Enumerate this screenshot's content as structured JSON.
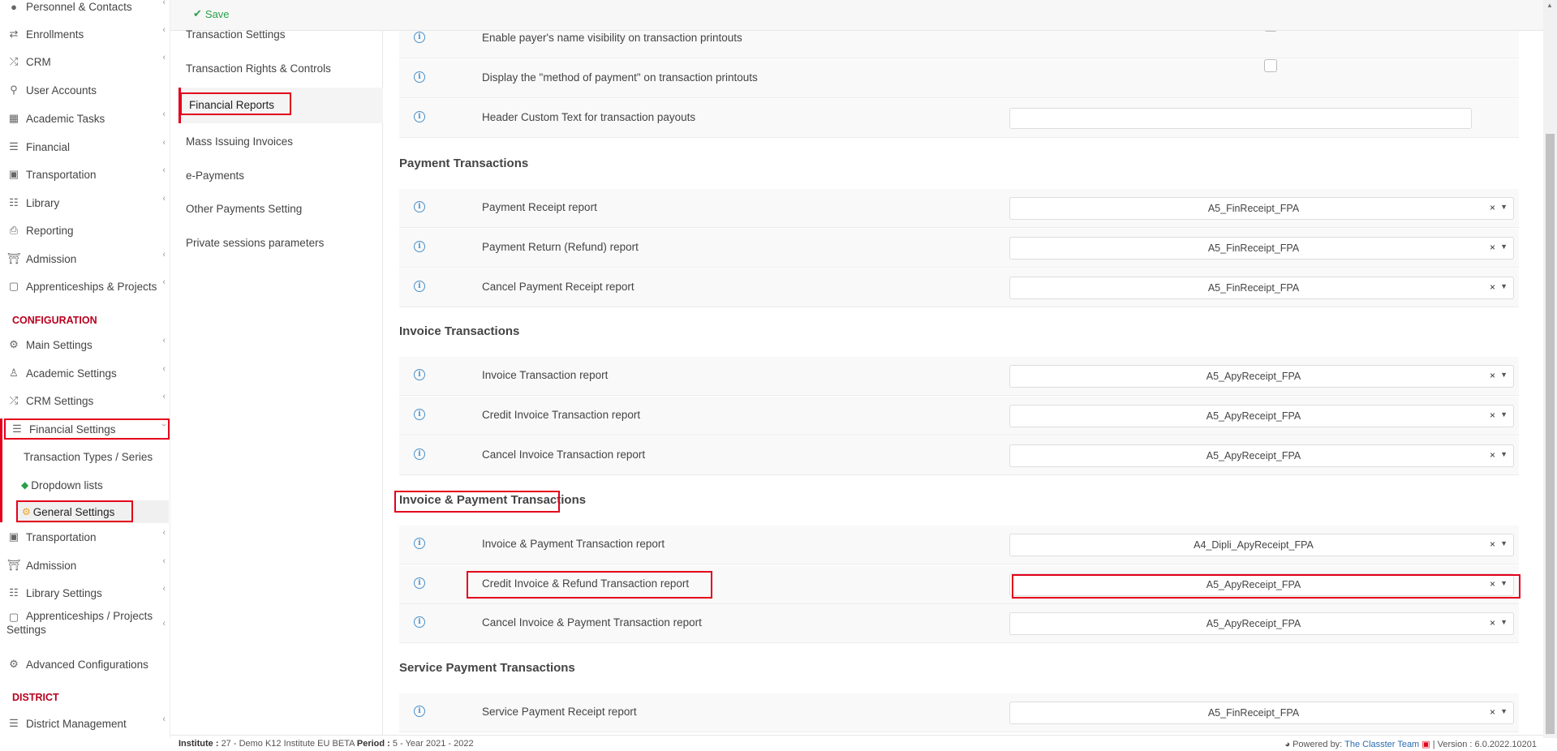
{
  "sidebar": {
    "items": [
      {
        "label": "Personnel & Contacts",
        "icon": "person-icon"
      },
      {
        "label": "Enrollments",
        "icon": "arrows-icon"
      },
      {
        "label": "CRM",
        "icon": "shuffle-icon"
      },
      {
        "label": "User Accounts",
        "icon": "key-icon"
      },
      {
        "label": "Academic Tasks",
        "icon": "grid-icon"
      },
      {
        "label": "Financial",
        "icon": "coins-icon"
      },
      {
        "label": "Transportation",
        "icon": "bus-icon"
      },
      {
        "label": "Library",
        "icon": "books-icon"
      },
      {
        "label": "Reporting",
        "icon": "printer-icon"
      },
      {
        "label": "Admission",
        "icon": "bank-icon"
      },
      {
        "label": "Apprenticeships & Projects",
        "icon": "box-icon"
      }
    ],
    "config_header": "CONFIGURATION",
    "config_items": [
      {
        "label": "Main Settings",
        "icon": "sliders-icon"
      },
      {
        "label": "Academic Settings",
        "icon": "people-icon"
      },
      {
        "label": "CRM Settings",
        "icon": "shuffle-icon"
      },
      {
        "label": "Financial Settings",
        "icon": "coins-icon"
      }
    ],
    "financial_sub": [
      {
        "label": "Transaction Types / Series"
      },
      {
        "label": "Dropdown lists",
        "icon": "layers-icon"
      },
      {
        "label": "General Settings",
        "icon": "gear-icon"
      }
    ],
    "config_items_2": [
      {
        "label": "Transportation",
        "icon": "bus-icon"
      },
      {
        "label": "Admission",
        "icon": "bank-icon"
      },
      {
        "label": "Library Settings",
        "icon": "books-icon"
      },
      {
        "label": "Apprenticeships / Projects",
        "label2": "Settings",
        "icon": "box-icon"
      },
      {
        "label": "Advanced Configurations",
        "icon": "gears-icon"
      }
    ],
    "district_header": "DISTRICT",
    "district_items": [
      {
        "label": "District Management",
        "icon": "list-icon"
      }
    ]
  },
  "topbar": {
    "save_label": "Save"
  },
  "submenu": {
    "items": [
      "Transaction Settings",
      "Transaction Rights & Controls",
      "Financial Reports",
      "Mass Issuing Invoices",
      "e-Payments",
      "Other Payments Setting",
      "Private sessions parameters"
    ]
  },
  "main": {
    "top_rows": [
      "Enable payer's name visibility on transaction printouts",
      "Display the \"method of payment\" on transaction printouts",
      "Header Custom Text for transaction payouts"
    ],
    "groups": [
      {
        "title": "Payment Transactions",
        "rows": [
          {
            "label": "Payment Receipt report",
            "value": "A5_FinReceipt_FPA"
          },
          {
            "label": "Payment Return (Refund) report",
            "value": "A5_FinReceipt_FPA"
          },
          {
            "label": "Cancel Payment Receipt report",
            "value": "A5_FinReceipt_FPA"
          }
        ]
      },
      {
        "title": "Invoice Transactions",
        "rows": [
          {
            "label": "Invoice Transaction report",
            "value": "A5_ApyReceipt_FPA"
          },
          {
            "label": "Credit Invoice Transaction report",
            "value": "A5_ApyReceipt_FPA"
          },
          {
            "label": "Cancel Invoice Transaction report",
            "value": "A5_ApyReceipt_FPA"
          }
        ]
      },
      {
        "title": "Invoice & Payment Transactions",
        "rows": [
          {
            "label": "Invoice & Payment Transaction report",
            "value": "A4_Dipli_ApyReceipt_FPA"
          },
          {
            "label": "Credit Invoice & Refund Transaction report",
            "value": "A5_ApyReceipt_FPA"
          },
          {
            "label": "Cancel Invoice & Payment Transaction report",
            "value": "A5_ApyReceipt_FPA"
          }
        ]
      },
      {
        "title": "Service Payment Transactions",
        "rows": [
          {
            "label": "Service Payment Receipt report",
            "value": "A5_FinReceipt_FPA"
          }
        ]
      }
    ]
  },
  "footer": {
    "institute_label": "Institute :",
    "institute_value": "27 - Demo K12 Institute EU BETA",
    "period_label": "Period :",
    "period_value": "5 - Year 2021 - 2022",
    "powered_label": "Powered by:",
    "powered_link": "The Classter Team",
    "version_label": "| Version :",
    "version_value": "6.0.2022.10201"
  },
  "colors": {
    "accent_red": "#e3001b",
    "save_green": "#2aa04a",
    "info_blue": "#4a90c9"
  }
}
